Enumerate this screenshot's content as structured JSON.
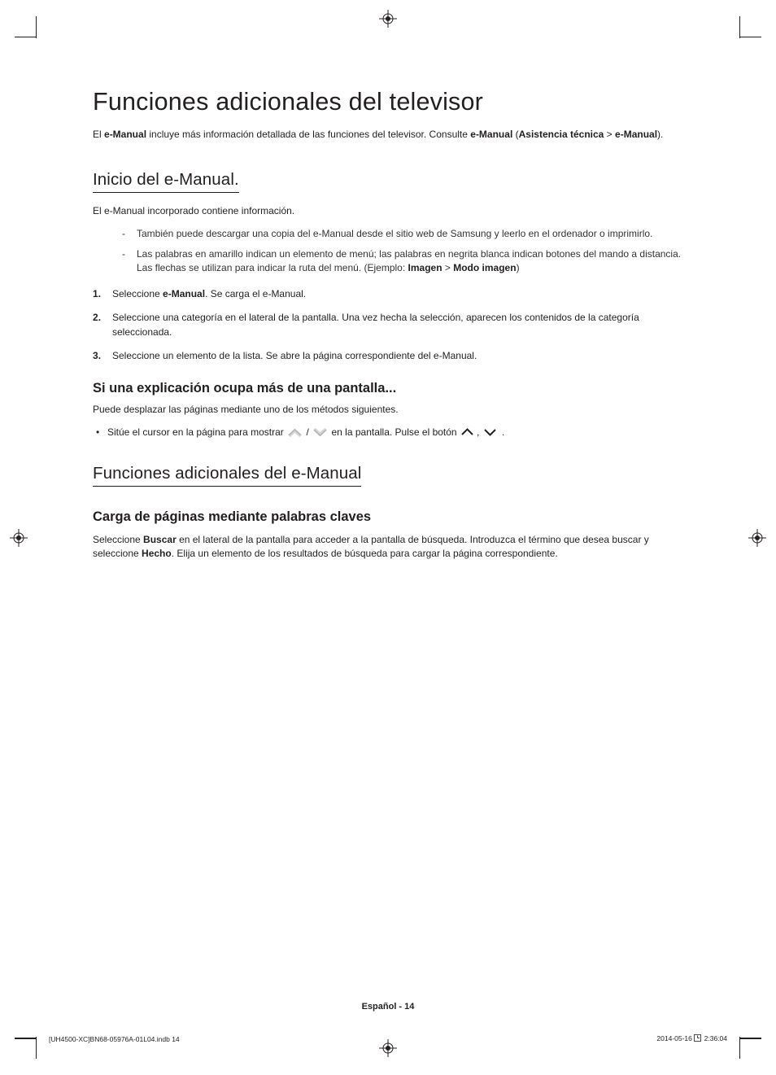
{
  "title": "Funciones adicionales del televisor",
  "intro": {
    "pre": "El ",
    "bold1": "e-Manual",
    "mid1": " incluye más información detallada de las funciones del televisor. Consulte ",
    "bold2": "e-Manual",
    "mid2": " (",
    "bold3": "Asistencia técnica",
    "mid3": " > ",
    "bold4": "e-Manual",
    "tail": ")."
  },
  "section1": {
    "heading": "Inicio del e-Manual.",
    "lead": "El e-Manual incorporado contiene información.",
    "dash1": "También puede descargar una copia del e-Manual desde el sitio web de Samsung y leerlo en el ordenador o imprimirlo.",
    "dash2": {
      "pre": "Las palabras en amarillo indican un elemento de menú; las palabras en negrita blanca indican botones del mando a distancia. Las flechas se utilizan para indicar la ruta del menú. (Ejemplo: ",
      "b1": "Imagen",
      "mid": " > ",
      "b2": "Modo imagen",
      "post": ")"
    },
    "steps": {
      "s1": {
        "pre": "Seleccione ",
        "b": "e-Manual",
        "post": ". Se carga el e-Manual."
      },
      "s2": "Seleccione una categoría en el lateral de la pantalla. Una vez hecha la selección, aparecen los contenidos de la categoría seleccionada.",
      "s3": "Seleccione un elemento de la lista. Se abre la página correspondiente del e-Manual."
    },
    "sub": {
      "heading": "Si una explicación ocupa más de una pantalla...",
      "line": "Puede desplazar las páginas mediante uno de los métodos siguientes.",
      "bullet": {
        "pre": "Sitúe el cursor en la página para mostrar ",
        "sep": " / ",
        "mid": " en la pantalla. Pulse el botón ",
        "comma": ", ",
        "post": " ."
      }
    }
  },
  "section2": {
    "heading": "Funciones adicionales del e-Manual",
    "sub_heading": "Carga de páginas mediante palabras claves",
    "para": {
      "pre": "Seleccione ",
      "b1": "Buscar",
      "mid1": " en el lateral de la pantalla para acceder a la pantalla de búsqueda. Introduzca el término que desea buscar y seleccione ",
      "b2": "Hecho",
      "post": ". Elija un elemento de los resultados de búsqueda para cargar la página correspondiente."
    }
  },
  "footer": {
    "center": "Español - 14",
    "slug_left": "[UH4500-XC]BN68-05976A-01L04.indb   14",
    "slug_right_date": "2014-05-16   ",
    "slug_right_time": "2:36:04"
  }
}
